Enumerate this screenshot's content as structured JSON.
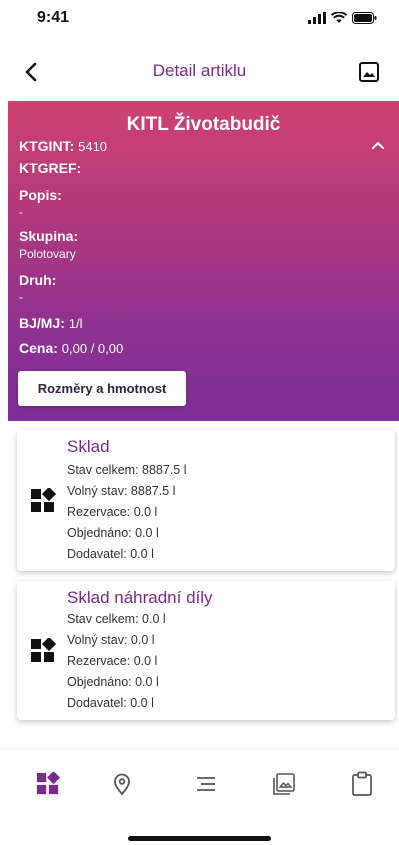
{
  "status": {
    "time": "9:41"
  },
  "nav": {
    "title": "Detail artiklu"
  },
  "header": {
    "title": "KITL Životabudič",
    "ktgint_label": "KTGINT:",
    "ktgint_value": "5410",
    "ktgref_label": "KTGREF:",
    "popis_label": "Popis:",
    "popis_value": "-",
    "skupina_label": "Skupina:",
    "skupina_value": "Polotovary",
    "druh_label": "Druh:",
    "druh_value": "-",
    "bjmj_label": "BJ/MJ:",
    "bjmj_value": "1/l",
    "cena_label": "Cena:",
    "cena_value": "0,00  / 0,00",
    "button_label": "Rozměry a hmotnost"
  },
  "cards": [
    {
      "title": "Sklad",
      "lines": [
        "Stav celkem: 8887.5 l",
        "Volný stav: 8887.5 l",
        "Rezervace: 0.0 l",
        "Objednáno: 0.0 l",
        "Dodavatel: 0.0 l"
      ]
    },
    {
      "title": "Sklad náhradní díly",
      "lines": [
        "Stav celkem: 0.0 l",
        "Volný stav: 0.0 l",
        "Rezervace: 0.0 l",
        "Objednáno: 0.0 l",
        "Dodavatel: 0.0 l"
      ]
    }
  ],
  "colors": {
    "accent": "#7a2a8c",
    "gradient_top": "#cf4270",
    "gradient_bottom": "#7b2f98"
  },
  "tabs": [
    "dashboard-icon",
    "location-icon",
    "list-icon",
    "gallery-icon",
    "clipboard-icon"
  ]
}
